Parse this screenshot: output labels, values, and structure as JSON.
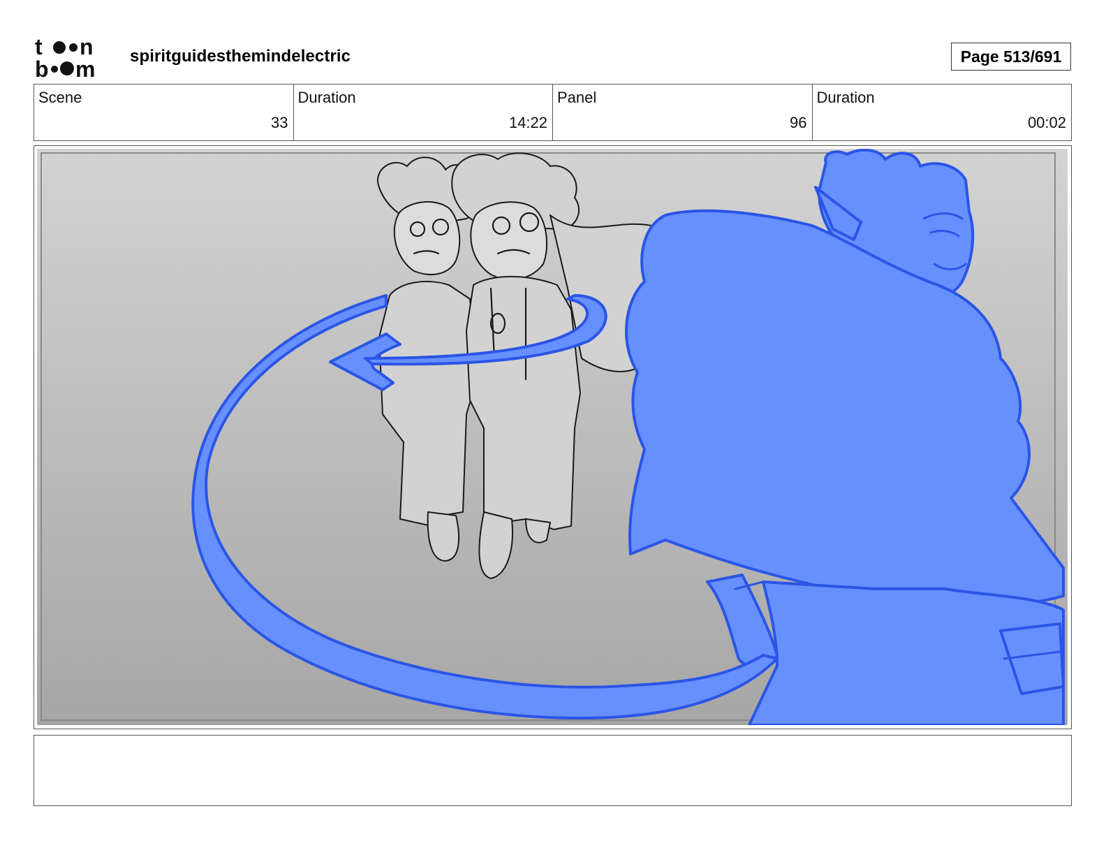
{
  "header": {
    "logo_alt": "toon boom",
    "project_title": "spiritguidesthemindelectric",
    "page_indicator": "Page 513/691"
  },
  "panel_info": {
    "scene_label": "Scene",
    "scene_value": "33",
    "scene_duration_label": "Duration",
    "scene_duration_value": "14:22",
    "panel_label": "Panel",
    "panel_value": "96",
    "panel_duration_label": "Duration",
    "panel_duration_value": "00:02"
  },
  "notes": {
    "text": ""
  },
  "colors": {
    "accent_blue": "#6790ff",
    "line_blue": "#2a55e6",
    "sketch_line": "#1a1a1a",
    "bg_top": "#d3d3d3",
    "bg_bottom": "#a6a6a6"
  }
}
